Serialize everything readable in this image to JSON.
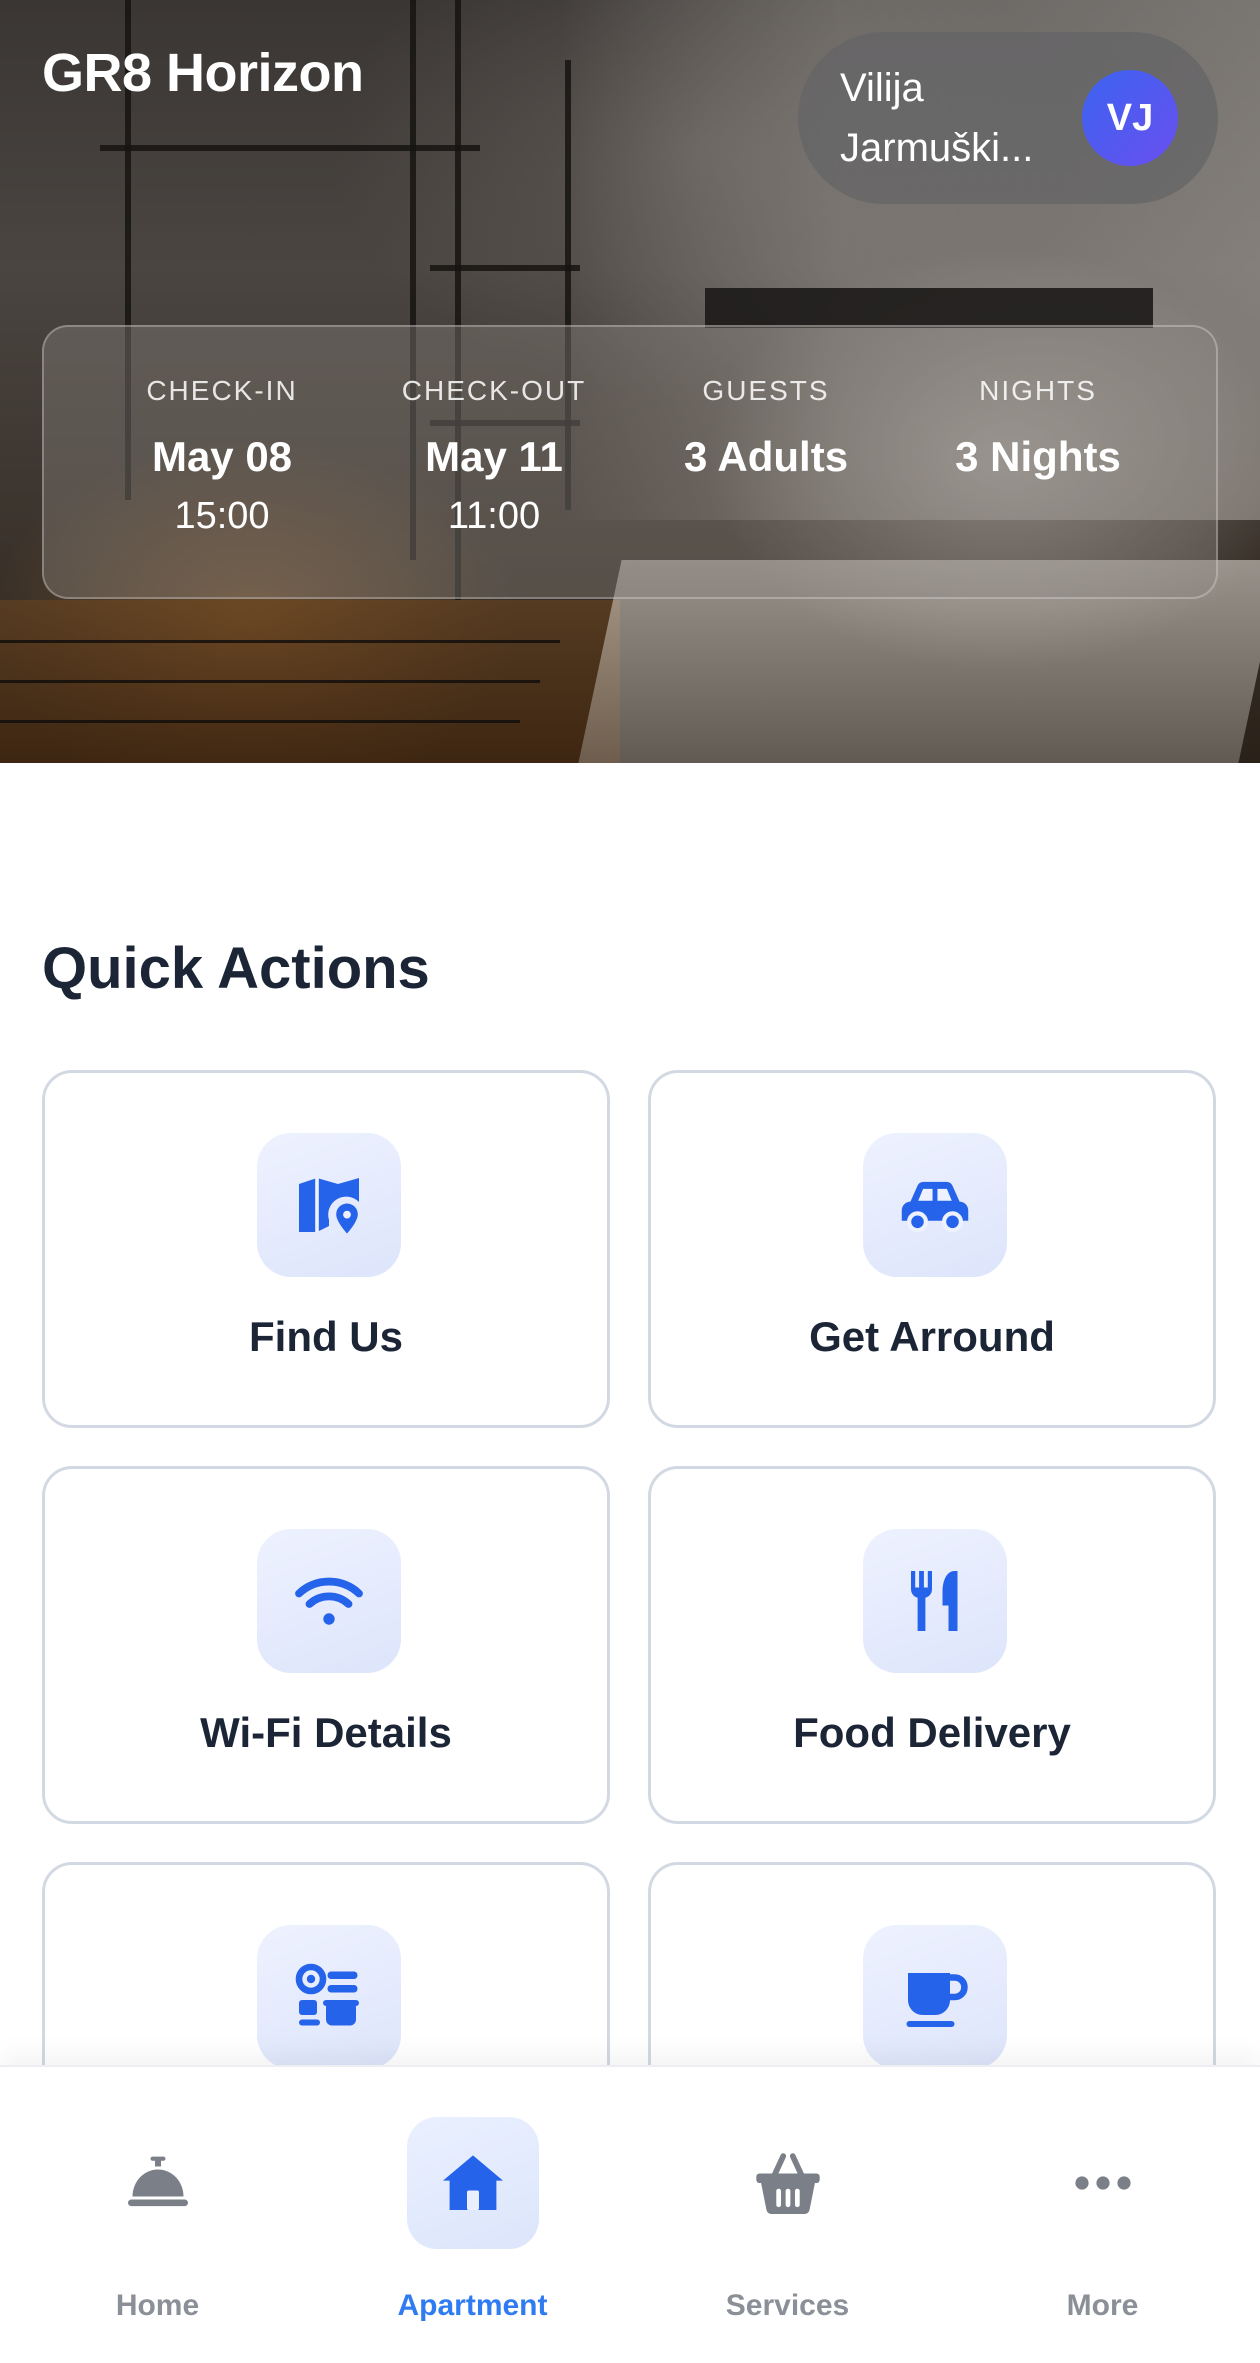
{
  "header": {
    "hotel_name": "GR8 Horizon",
    "user_first": "Vilija",
    "user_last": "Jarmuški...",
    "avatar_initials": "VJ"
  },
  "stay": [
    {
      "label": "CHECK-IN",
      "value": "May 08",
      "time": "15:00"
    },
    {
      "label": "CHECK-OUT",
      "value": "May 11",
      "time": "11:00"
    },
    {
      "label": "GUESTS",
      "value": "3 Adults",
      "time": ""
    },
    {
      "label": "NIGHTS",
      "value": "3 Nights",
      "time": ""
    }
  ],
  "quick_actions": {
    "title": "Quick Actions",
    "items": [
      {
        "label": "Find Us",
        "icon": "map-pin-icon"
      },
      {
        "label": "Get Arround",
        "icon": "car-icon"
      },
      {
        "label": "Wi-Fi Details",
        "icon": "wifi-icon"
      },
      {
        "label": "Food Delivery",
        "icon": "utensils-icon"
      },
      {
        "label": "",
        "icon": "kitchen-appliances-icon"
      },
      {
        "label": "",
        "icon": "coffee-cup-icon"
      }
    ]
  },
  "bottom_nav": {
    "items": [
      {
        "label": "Home",
        "icon": "bell-icon"
      },
      {
        "label": "Apartment",
        "icon": "house-icon"
      },
      {
        "label": "Services",
        "icon": "basket-icon"
      },
      {
        "label": "More",
        "icon": "more-icon"
      }
    ],
    "active": "Apartment"
  },
  "colors": {
    "accent": "#2f7bf2",
    "icon_blue": "#2563eb",
    "heading": "#1b2536",
    "nav_inactive": "#8a8f98"
  }
}
